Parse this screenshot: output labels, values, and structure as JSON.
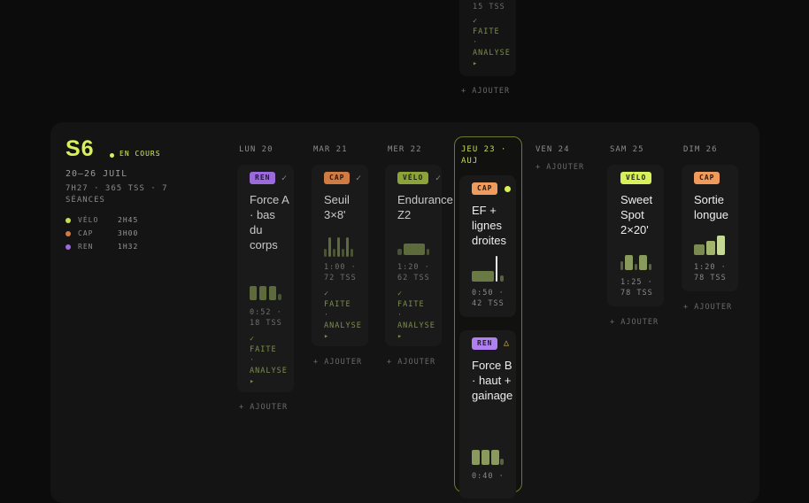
{
  "previous_week": {
    "meta": "15 TSS",
    "done": "✓",
    "faite": "FAITE",
    "sep": "·",
    "analyse": "ANALYSE",
    "arrow": "▸",
    "add": "+ AJOUTER"
  },
  "week": {
    "title": "S6",
    "status": "EN COURS",
    "dates": "20–26 JUIL",
    "stats": "7H27 · 365 TSS · 7 SÉANCES",
    "legend": [
      {
        "name": "VÉLO",
        "duration": "2H45",
        "color": "#c7dd56"
      },
      {
        "name": "CAP",
        "duration": "3H00",
        "color": "#d07a44"
      },
      {
        "name": "REN",
        "duration": "1H32",
        "color": "#9b6bdc"
      }
    ]
  },
  "days": [
    {
      "label": "LUN 20"
    },
    {
      "label": "MAR 21"
    },
    {
      "label": "MER 22"
    },
    {
      "label": "JEU 23 · AUJ",
      "today": true
    },
    {
      "label": "VEN 24"
    },
    {
      "label": "SAM 25"
    },
    {
      "label": "DIM 26"
    }
  ],
  "sessions": {
    "lun": {
      "tag": "REN",
      "done": "✓",
      "title": "Force A · bas du corps",
      "meta": "0:52 · 18 TSS",
      "status_check": "✓",
      "status_done": "FAITE",
      "status_sep": "·",
      "status_analyse": "ANALYSE",
      "status_arrow": "▸"
    },
    "mar": {
      "tag": "CAP",
      "done": "✓",
      "title": "Seuil 3×8'",
      "meta": "1:00 · 72 TSS",
      "status_check": "✓",
      "status_done": "FAITE",
      "status_sep": "·",
      "status_analyse": "ANALYSE",
      "status_arrow": "▸"
    },
    "mer": {
      "tag": "VÉLO",
      "done": "✓",
      "title": "Endurance Z2",
      "meta": "1:20 · 62 TSS",
      "status_check": "✓",
      "status_done": "FAITE",
      "status_sep": "·",
      "status_analyse": "ANALYSE",
      "status_arrow": "▸"
    },
    "jeu1": {
      "tag": "CAP",
      "title": "EF + lignes droites",
      "meta": "0:50 · 42 TSS"
    },
    "jeu2": {
      "tag": "REN",
      "warn": "△",
      "title": "Force B · haut + gainage",
      "meta": "0:40 ·"
    },
    "sam": {
      "tag": "VÉLO",
      "title": "Sweet Spot 2×20'",
      "meta": "1:25 · 78 TSS"
    },
    "dim": {
      "tag": "CAP",
      "title": "Sortie longue",
      "meta": "1:20 · 78 TSS"
    }
  },
  "add_label": "+ AJOUTER",
  "colors": {
    "accent": "#d8f05a",
    "velo": "#c7dd56",
    "cap": "#d07a44",
    "ren": "#9b6bdc"
  }
}
